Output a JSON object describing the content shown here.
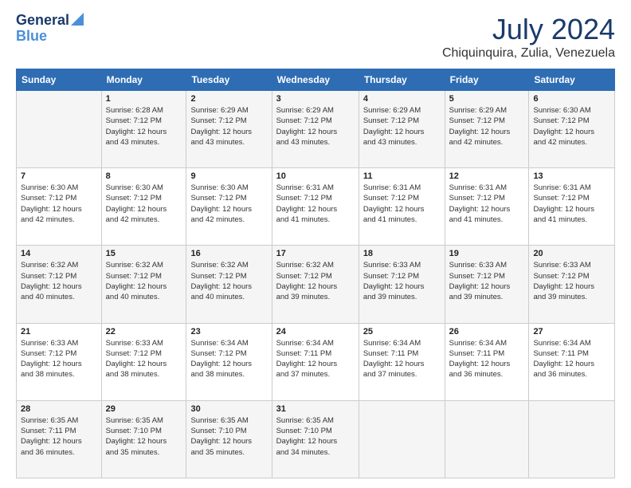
{
  "logo": {
    "line1": "General",
    "line2": "Blue"
  },
  "title": {
    "month_year": "July 2024",
    "location": "Chiquinquira, Zulia, Venezuela"
  },
  "header_days": [
    "Sunday",
    "Monday",
    "Tuesday",
    "Wednesday",
    "Thursday",
    "Friday",
    "Saturday"
  ],
  "weeks": [
    [
      {
        "day": "",
        "info": ""
      },
      {
        "day": "1",
        "info": "Sunrise: 6:28 AM\nSunset: 7:12 PM\nDaylight: 12 hours\nand 43 minutes."
      },
      {
        "day": "2",
        "info": "Sunrise: 6:29 AM\nSunset: 7:12 PM\nDaylight: 12 hours\nand 43 minutes."
      },
      {
        "day": "3",
        "info": "Sunrise: 6:29 AM\nSunset: 7:12 PM\nDaylight: 12 hours\nand 43 minutes."
      },
      {
        "day": "4",
        "info": "Sunrise: 6:29 AM\nSunset: 7:12 PM\nDaylight: 12 hours\nand 43 minutes."
      },
      {
        "day": "5",
        "info": "Sunrise: 6:29 AM\nSunset: 7:12 PM\nDaylight: 12 hours\nand 42 minutes."
      },
      {
        "day": "6",
        "info": "Sunrise: 6:30 AM\nSunset: 7:12 PM\nDaylight: 12 hours\nand 42 minutes."
      }
    ],
    [
      {
        "day": "7",
        "info": "Sunrise: 6:30 AM\nSunset: 7:12 PM\nDaylight: 12 hours\nand 42 minutes."
      },
      {
        "day": "8",
        "info": "Sunrise: 6:30 AM\nSunset: 7:12 PM\nDaylight: 12 hours\nand 42 minutes."
      },
      {
        "day": "9",
        "info": "Sunrise: 6:30 AM\nSunset: 7:12 PM\nDaylight: 12 hours\nand 42 minutes."
      },
      {
        "day": "10",
        "info": "Sunrise: 6:31 AM\nSunset: 7:12 PM\nDaylight: 12 hours\nand 41 minutes."
      },
      {
        "day": "11",
        "info": "Sunrise: 6:31 AM\nSunset: 7:12 PM\nDaylight: 12 hours\nand 41 minutes."
      },
      {
        "day": "12",
        "info": "Sunrise: 6:31 AM\nSunset: 7:12 PM\nDaylight: 12 hours\nand 41 minutes."
      },
      {
        "day": "13",
        "info": "Sunrise: 6:31 AM\nSunset: 7:12 PM\nDaylight: 12 hours\nand 41 minutes."
      }
    ],
    [
      {
        "day": "14",
        "info": "Sunrise: 6:32 AM\nSunset: 7:12 PM\nDaylight: 12 hours\nand 40 minutes."
      },
      {
        "day": "15",
        "info": "Sunrise: 6:32 AM\nSunset: 7:12 PM\nDaylight: 12 hours\nand 40 minutes."
      },
      {
        "day": "16",
        "info": "Sunrise: 6:32 AM\nSunset: 7:12 PM\nDaylight: 12 hours\nand 40 minutes."
      },
      {
        "day": "17",
        "info": "Sunrise: 6:32 AM\nSunset: 7:12 PM\nDaylight: 12 hours\nand 39 minutes."
      },
      {
        "day": "18",
        "info": "Sunrise: 6:33 AM\nSunset: 7:12 PM\nDaylight: 12 hours\nand 39 minutes."
      },
      {
        "day": "19",
        "info": "Sunrise: 6:33 AM\nSunset: 7:12 PM\nDaylight: 12 hours\nand 39 minutes."
      },
      {
        "day": "20",
        "info": "Sunrise: 6:33 AM\nSunset: 7:12 PM\nDaylight: 12 hours\nand 39 minutes."
      }
    ],
    [
      {
        "day": "21",
        "info": "Sunrise: 6:33 AM\nSunset: 7:12 PM\nDaylight: 12 hours\nand 38 minutes."
      },
      {
        "day": "22",
        "info": "Sunrise: 6:33 AM\nSunset: 7:12 PM\nDaylight: 12 hours\nand 38 minutes."
      },
      {
        "day": "23",
        "info": "Sunrise: 6:34 AM\nSunset: 7:12 PM\nDaylight: 12 hours\nand 38 minutes."
      },
      {
        "day": "24",
        "info": "Sunrise: 6:34 AM\nSunset: 7:11 PM\nDaylight: 12 hours\nand 37 minutes."
      },
      {
        "day": "25",
        "info": "Sunrise: 6:34 AM\nSunset: 7:11 PM\nDaylight: 12 hours\nand 37 minutes."
      },
      {
        "day": "26",
        "info": "Sunrise: 6:34 AM\nSunset: 7:11 PM\nDaylight: 12 hours\nand 36 minutes."
      },
      {
        "day": "27",
        "info": "Sunrise: 6:34 AM\nSunset: 7:11 PM\nDaylight: 12 hours\nand 36 minutes."
      }
    ],
    [
      {
        "day": "28",
        "info": "Sunrise: 6:35 AM\nSunset: 7:11 PM\nDaylight: 12 hours\nand 36 minutes."
      },
      {
        "day": "29",
        "info": "Sunrise: 6:35 AM\nSunset: 7:10 PM\nDaylight: 12 hours\nand 35 minutes."
      },
      {
        "day": "30",
        "info": "Sunrise: 6:35 AM\nSunset: 7:10 PM\nDaylight: 12 hours\nand 35 minutes."
      },
      {
        "day": "31",
        "info": "Sunrise: 6:35 AM\nSunset: 7:10 PM\nDaylight: 12 hours\nand 34 minutes."
      },
      {
        "day": "",
        "info": ""
      },
      {
        "day": "",
        "info": ""
      },
      {
        "day": "",
        "info": ""
      }
    ]
  ]
}
